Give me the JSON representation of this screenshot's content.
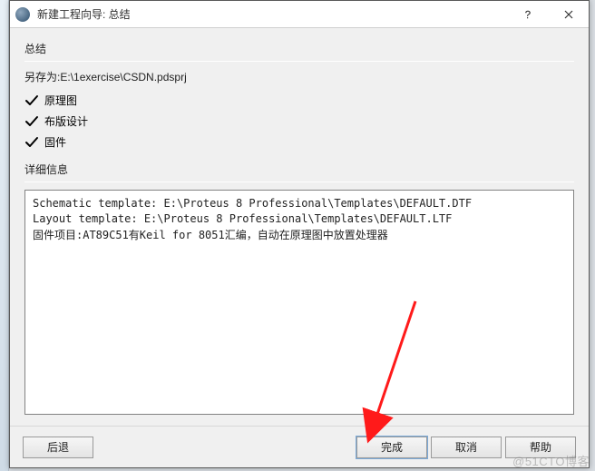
{
  "title": "新建工程向导: 总结",
  "sections": {
    "summary": "总结",
    "details": "详细信息"
  },
  "save_prefix": "另存为",
  "save_path": "E:\\1exercise\\CSDN.pdsprj",
  "checks": [
    {
      "label": "原理图"
    },
    {
      "label": "布版设计"
    },
    {
      "label": "固件"
    }
  ],
  "details_text": "Schematic template: E:\\Proteus 8 Professional\\Templates\\DEFAULT.DTF\nLayout template: E:\\Proteus 8 Professional\\Templates\\DEFAULT.LTF\n固件项目:AT89C51有Keil for 8051汇编，自动在原理图中放置处理器",
  "buttons": {
    "back": "后退",
    "finish": "完成",
    "cancel": "取消",
    "help": "帮助"
  },
  "watermark": "@51CTO博客"
}
